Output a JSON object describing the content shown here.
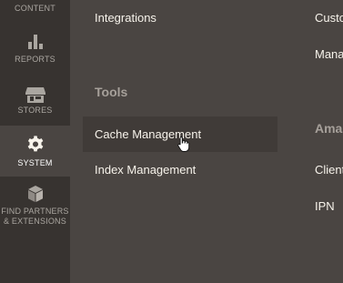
{
  "sidebar": {
    "items": [
      {
        "label": "CONTENT",
        "icon": "content-icon"
      },
      {
        "label": "REPORTS",
        "icon": "bar-chart-icon"
      },
      {
        "label": "STORES",
        "icon": "store-icon"
      },
      {
        "label": "SYSTEM",
        "icon": "gear-icon",
        "active": true
      },
      {
        "label_line1": "FIND PARTNERS",
        "label_line2": "& EXTENSIONS",
        "icon": "blocks-icon"
      }
    ]
  },
  "menu": {
    "col1": {
      "top_link": "Integrations",
      "section_title": "Tools",
      "links": [
        "Cache Management",
        "Index Management"
      ]
    },
    "col2": {
      "top_links": [
        "Custo",
        "Mana"
      ],
      "section_title": "Ama",
      "links": [
        "Client",
        "IPN"
      ]
    }
  },
  "colors": {
    "sidebar_bg": "#373330",
    "panel_bg": "#4a4542",
    "link_text": "#f7f3eb",
    "section_title": "#a6a09a"
  }
}
